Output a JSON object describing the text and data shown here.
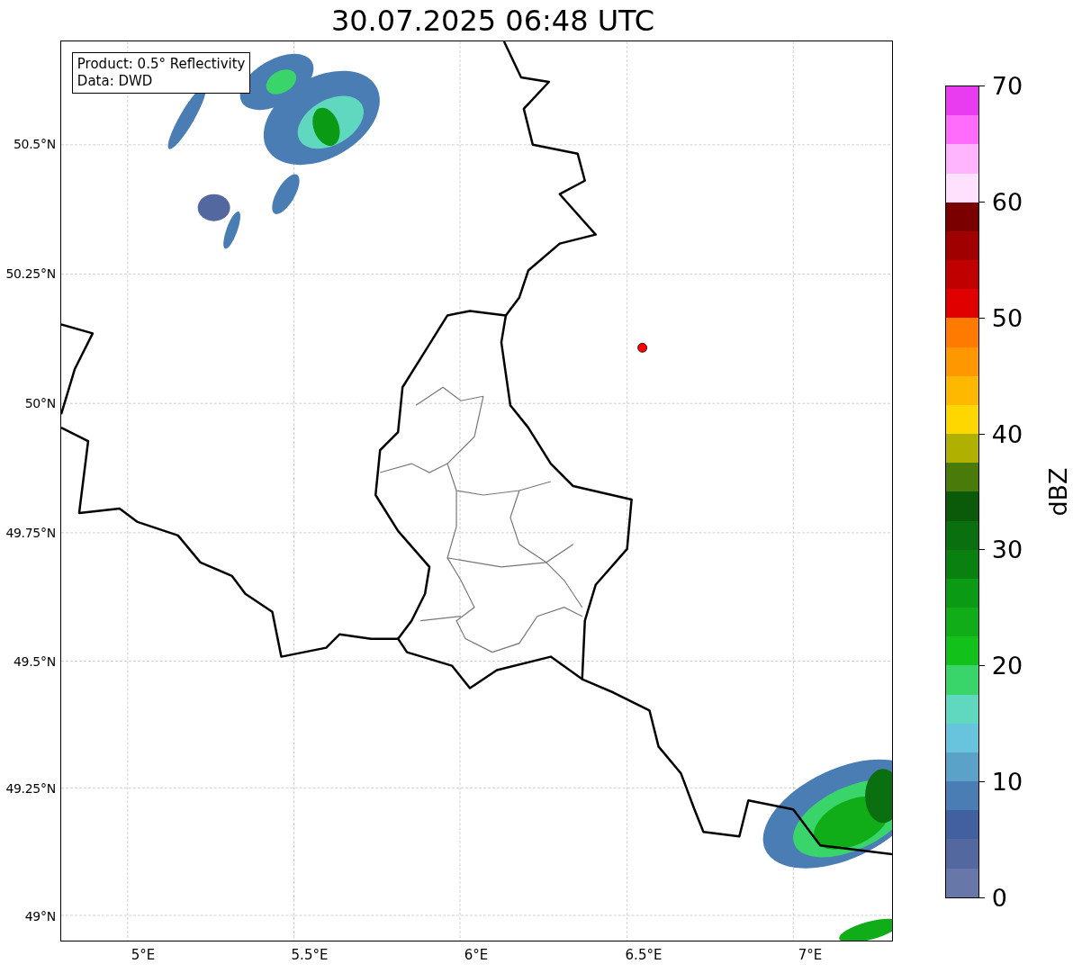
{
  "title": "30.07.2025 06:48 UTC",
  "info_box": {
    "lines": [
      "Product: 0.5° Reflectivity",
      "Data: DWD"
    ]
  },
  "y_ticks": [
    "50.5°N",
    "50.25°N",
    "50°N",
    "49.75°N",
    "49.5°N",
    "49.25°N",
    "49°N"
  ],
  "x_ticks": [
    "5°E",
    "5.5°E",
    "6°E",
    "6.5°E",
    "7°E"
  ],
  "colorbar": {
    "label": "dBZ",
    "ticks": [
      "70",
      "60",
      "50",
      "40",
      "30",
      "20",
      "10",
      "0"
    ],
    "bands": [
      {
        "color": "#e93bef"
      },
      {
        "color": "#ff6cfb"
      },
      {
        "color": "#ffb4fd"
      },
      {
        "color": "#ffe0fd"
      },
      {
        "color": "#7a0000"
      },
      {
        "color": "#a00000"
      },
      {
        "color": "#c00000"
      },
      {
        "color": "#e00000"
      },
      {
        "color": "#ff7a00"
      },
      {
        "color": "#ff9800"
      },
      {
        "color": "#ffb800"
      },
      {
        "color": "#ffd700"
      },
      {
        "color": "#b0b000"
      },
      {
        "color": "#4a7a0a"
      },
      {
        "color": "#0a5a0a"
      },
      {
        "color": "#0a700f"
      },
      {
        "color": "#0a8010"
      },
      {
        "color": "#0a9a14"
      },
      {
        "color": "#10ad18"
      },
      {
        "color": "#12c21a"
      },
      {
        "color": "#3ad56a"
      },
      {
        "color": "#60d8c0"
      },
      {
        "color": "#68c3dc"
      },
      {
        "color": "#5aa2c8"
      },
      {
        "color": "#4a7db3"
      },
      {
        "color": "#4260a0"
      },
      {
        "color": "#5468a0"
      },
      {
        "color": "#6677a8"
      }
    ]
  }
}
